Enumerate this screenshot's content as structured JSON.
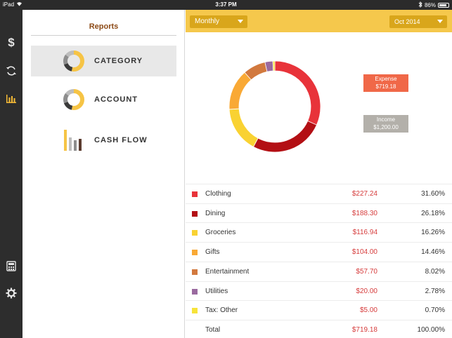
{
  "status_bar": {
    "device": "iPad",
    "time": "3:37 PM",
    "battery": "86%",
    "battery_level": 0.86
  },
  "rail": {
    "icons": [
      "dollar-icon",
      "sync-icon",
      "bar-chart-icon",
      "calculator-icon",
      "gear-icon"
    ]
  },
  "reports": {
    "title": "Reports",
    "items": [
      {
        "label": "CATEGORY",
        "icon": "category-donut-icon",
        "active": true
      },
      {
        "label": "ACCOUNT",
        "icon": "account-donut-icon",
        "active": false
      },
      {
        "label": "CASH FLOW",
        "icon": "cash-flow-bars-icon",
        "active": false
      }
    ]
  },
  "toolbar": {
    "period": "Monthly",
    "month": "Oct 2014"
  },
  "summary": {
    "expense_label": "Expense",
    "expense_value": "$719.18",
    "expense_color": "#f06848",
    "income_label": "Income",
    "income_value": "$1,200.00",
    "income_color": "#b3b0aa"
  },
  "chart_data": {
    "type": "pie",
    "categories": [
      "Clothing",
      "Dining",
      "Groceries",
      "Gifts",
      "Entertainment",
      "Utilities",
      "Tax: Other"
    ],
    "values": [
      31.6,
      26.18,
      16.26,
      14.46,
      8.02,
      2.78,
      0.7
    ],
    "colors": [
      "#e8333a",
      "#b30f14",
      "#f9d232",
      "#f9a935",
      "#d2793e",
      "#9a6a9f",
      "#f7e33a"
    ]
  },
  "categories": [
    {
      "name": "Clothing",
      "amount": "$227.24",
      "percent": "31.60%",
      "color": "#e8333a"
    },
    {
      "name": "Dining",
      "amount": "$188.30",
      "percent": "26.18%",
      "color": "#b30f14"
    },
    {
      "name": "Groceries",
      "amount": "$116.94",
      "percent": "16.26%",
      "color": "#f9d232"
    },
    {
      "name": "Gifts",
      "amount": "$104.00",
      "percent": "14.46%",
      "color": "#f9a935"
    },
    {
      "name": "Entertainment",
      "amount": "$57.70",
      "percent": "8.02%",
      "color": "#d2793e"
    },
    {
      "name": "Utilities",
      "amount": "$20.00",
      "percent": "2.78%",
      "color": "#9a6a9f"
    },
    {
      "name": "Tax: Other",
      "amount": "$5.00",
      "percent": "0.70%",
      "color": "#f7e33a"
    }
  ],
  "total": {
    "label": "Total",
    "amount": "$719.18",
    "percent": "100.00%"
  }
}
